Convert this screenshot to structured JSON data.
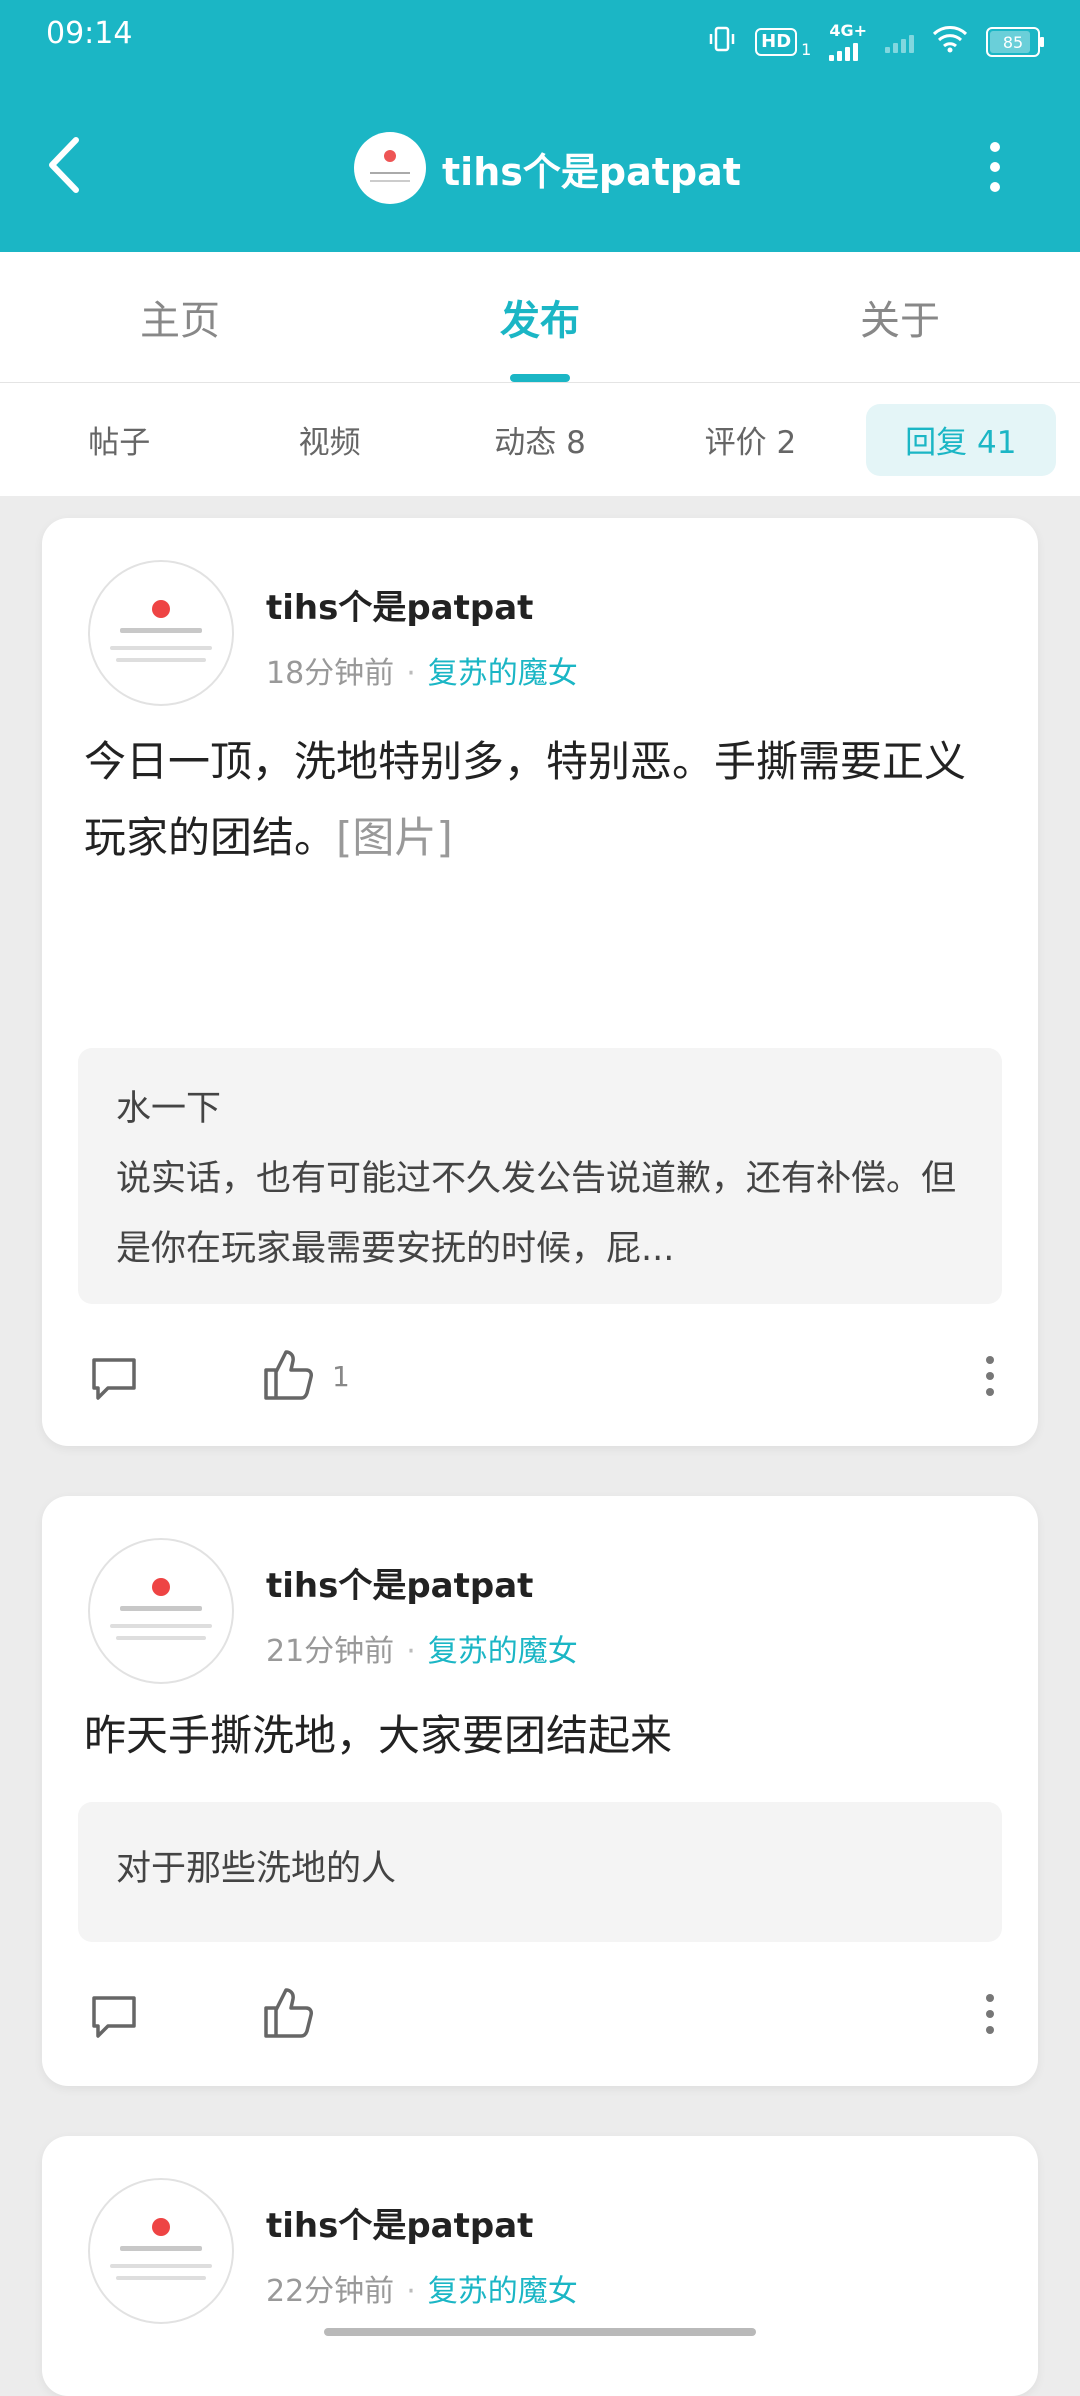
{
  "status_bar": {
    "time": "09:14",
    "hd": "HD",
    "sim": "1",
    "network": "4G+",
    "battery": "85"
  },
  "header": {
    "title": "tihs个是patpat",
    "colors": {
      "primary": "#1bb6c5",
      "text_on_primary": "#ffffff"
    }
  },
  "main_tabs": [
    {
      "label": "主页"
    },
    {
      "label": "发布",
      "active": true
    },
    {
      "label": "关于"
    }
  ],
  "sub_tabs": [
    {
      "label": "帖子"
    },
    {
      "label": "视频"
    },
    {
      "label": "动态 8"
    },
    {
      "label": "评价 2"
    },
    {
      "label": "回复 41",
      "active": true
    }
  ],
  "posts": [
    {
      "author": "tihs个是patpat",
      "time": "18分钟前",
      "forum": "复苏的魔女",
      "text": "今日一顶，洗地特别多，特别恶。手撕需要正义玩家的团结。",
      "image_tag": "[图片]",
      "quote_title": "水一下",
      "quote_body": "说实话，也有可能过不久发公告说道歉，还有补偿。但是你在玩家最需要安抚的时候，屁...",
      "like_count": "1"
    },
    {
      "author": "tihs个是patpat",
      "time": "21分钟前",
      "forum": "复苏的魔女",
      "text": "昨天手撕洗地，大家要团结起来",
      "image_tag": "",
      "quote_title": "",
      "quote_body": "对于那些洗地的人",
      "like_count": ""
    },
    {
      "author": "tihs个是patpat",
      "time": "22分钟前",
      "forum": "复苏的魔女"
    }
  ],
  "icons": [
    "back-arrow-icon",
    "more-vertical-icon",
    "comment-icon",
    "thumbs-up-icon"
  ]
}
